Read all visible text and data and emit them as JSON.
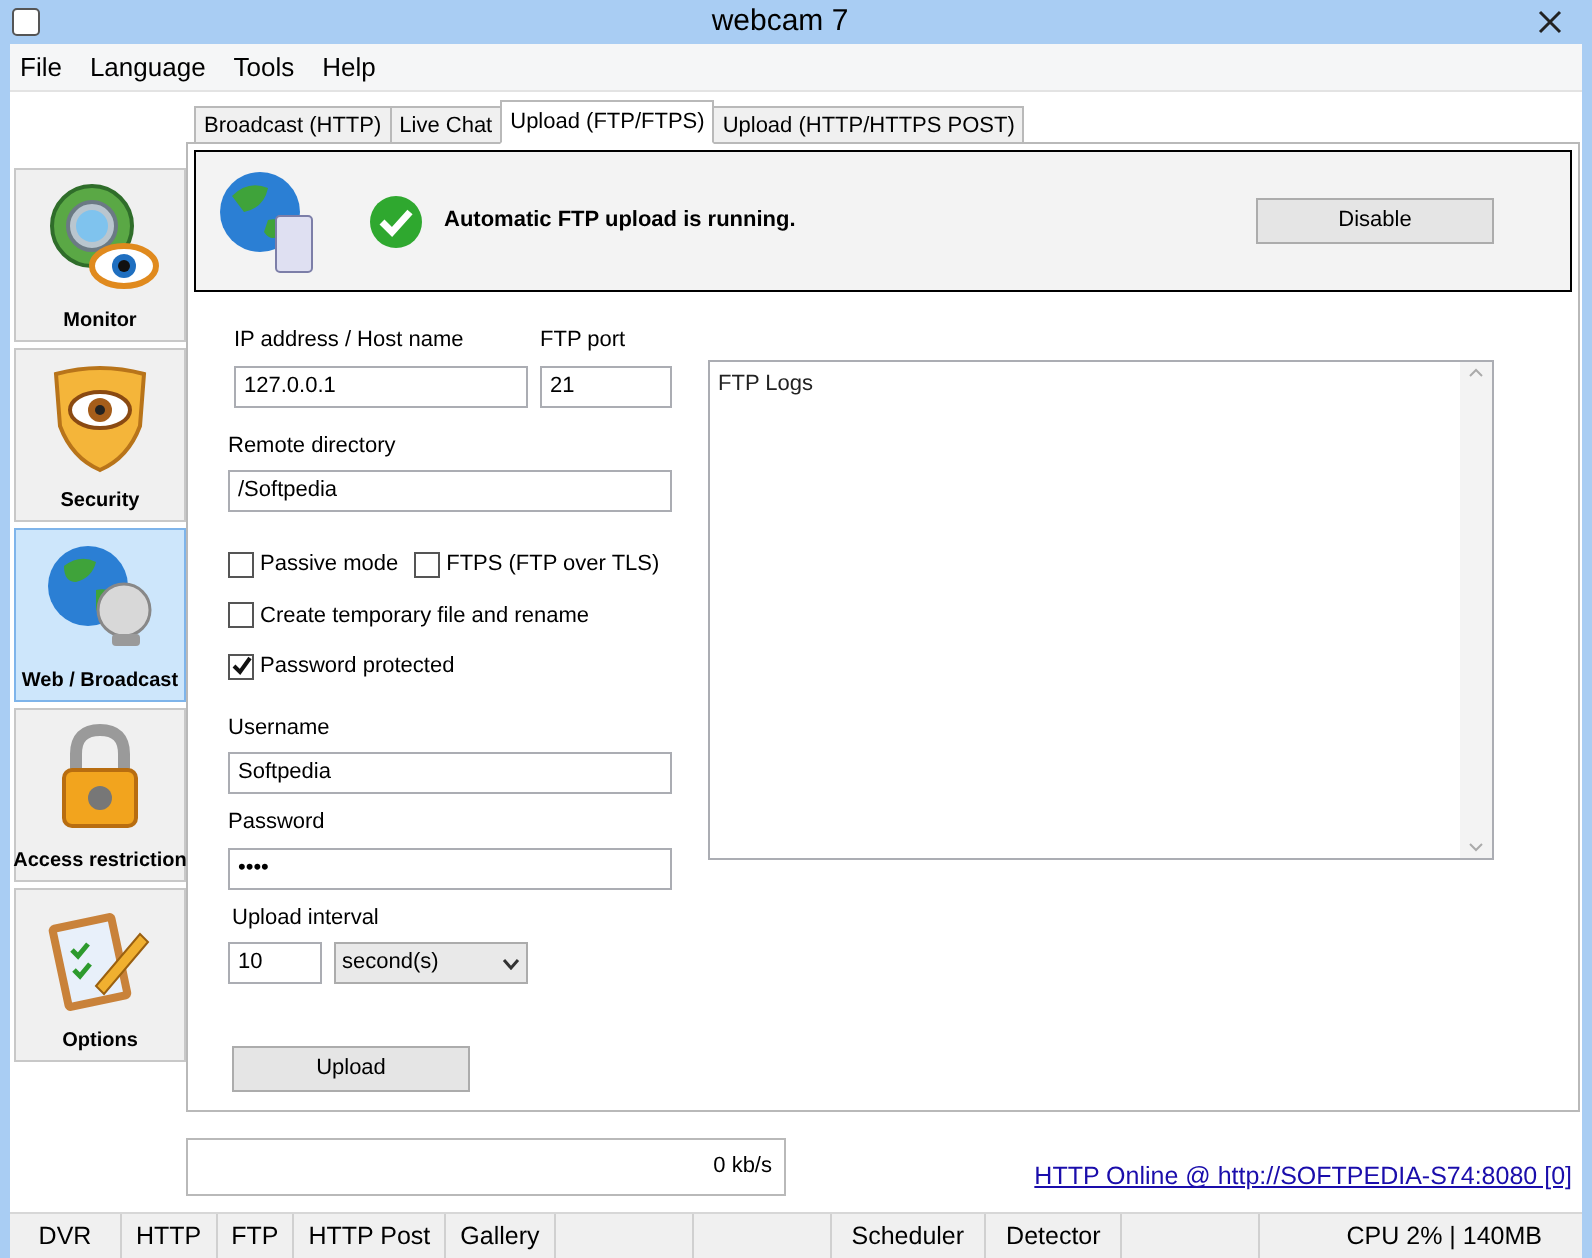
{
  "window": {
    "title": "webcam 7"
  },
  "menu": [
    "File",
    "Language",
    "Tools",
    "Help"
  ],
  "sidebar": {
    "items": [
      {
        "label": "Monitor",
        "kind": "monitor",
        "selected": false
      },
      {
        "label": "Security",
        "kind": "security",
        "selected": false
      },
      {
        "label": "Web / Broadcast",
        "kind": "web",
        "selected": true
      },
      {
        "label": "Access restriction",
        "kind": "lock",
        "selected": false
      },
      {
        "label": "Options",
        "kind": "options",
        "selected": false
      }
    ]
  },
  "tabs": [
    {
      "label": "Broadcast (HTTP)",
      "selected": false
    },
    {
      "label": "Live Chat",
      "selected": false
    },
    {
      "label": "Upload (FTP/FTPS)",
      "selected": true
    },
    {
      "label": "Upload (HTTP/HTTPS POST)",
      "selected": false
    }
  ],
  "banner": {
    "message": "Automatic FTP upload is running.",
    "running": true,
    "button": "Disable"
  },
  "form": {
    "host": {
      "label": "IP address / Host name",
      "value": "127.0.0.1"
    },
    "port": {
      "label": "FTP port",
      "value": "21"
    },
    "remote_directory": {
      "label": "Remote directory",
      "value": "/Softpedia"
    },
    "passive_mode": {
      "label": "Passive mode",
      "checked": false
    },
    "ftps": {
      "label": "FTPS (FTP over TLS)",
      "checked": false
    },
    "temporary_file": {
      "label": "Create temporary file and rename",
      "checked": false
    },
    "password_protected": {
      "label": "Password protected",
      "checked": true
    },
    "username": {
      "label": "Username",
      "value": "Softpedia"
    },
    "password": {
      "label": "Password",
      "value": "••••"
    },
    "interval": {
      "label": "Upload interval",
      "value": "10",
      "unit": "second(s)"
    },
    "upload_button": "Upload"
  },
  "logs": {
    "placeholder": "FTP Logs"
  },
  "bandwidth": "0 kb/s",
  "server_link": "HTTP Online @ http://SOFTPEDIA-S74:8080 [0]",
  "status_bar": {
    "left": [
      "DVR",
      "HTTP",
      "FTP",
      "HTTP Post",
      "Gallery"
    ],
    "middle": [
      "Scheduler",
      "Detector"
    ],
    "right": "CPU 2% | 140MB"
  }
}
